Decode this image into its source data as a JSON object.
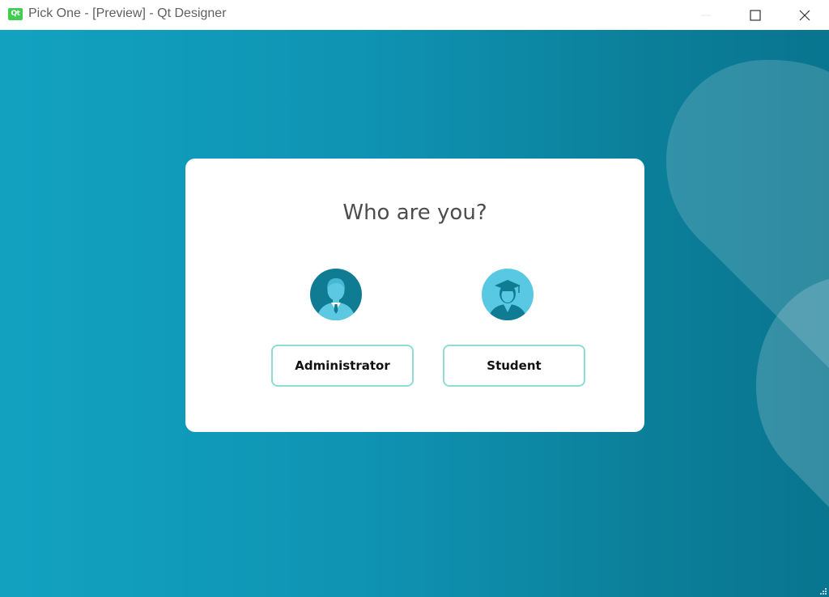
{
  "window": {
    "title": "Pick One - [Preview] - Qt Designer",
    "app_icon_label": "Qt",
    "controls": [
      "minimize",
      "maximize",
      "close"
    ]
  },
  "card": {
    "heading": "Who are you?",
    "roles": [
      {
        "label": "Administrator",
        "icon": "administrator-avatar-icon"
      },
      {
        "label": "Student",
        "icon": "student-graduate-avatar-icon"
      }
    ]
  },
  "colors": {
    "background_gradient": [
      "#12a2c1",
      "#09758f"
    ],
    "card": "#ffffff",
    "button_border": "#8fdbd6",
    "admin_avatar": "#0f7c93",
    "student_avatar": "#58c8e3",
    "heading_text": "#4d4d4d"
  }
}
